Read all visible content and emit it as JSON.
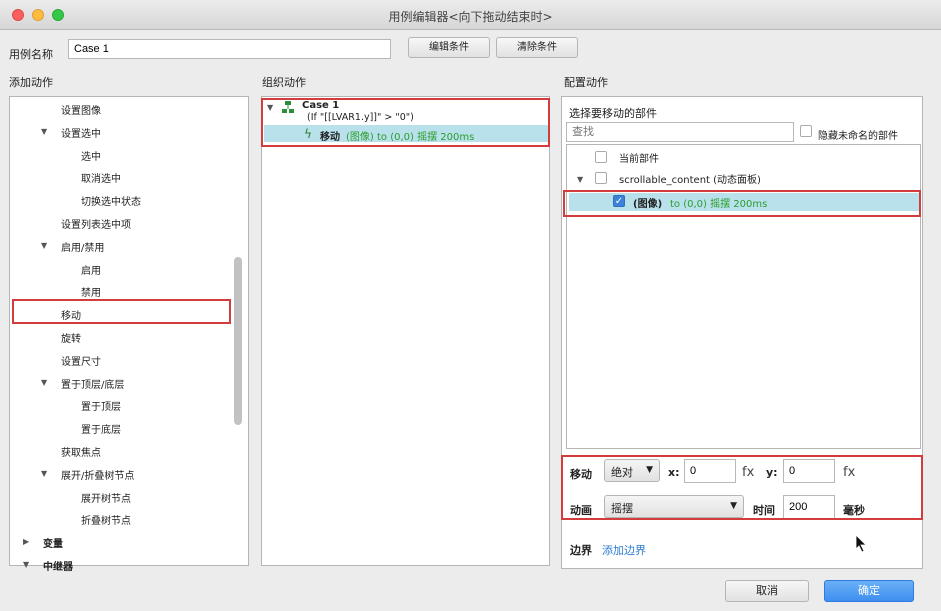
{
  "window": {
    "title": "用例编辑器<向下拖动结束时>"
  },
  "case_name": {
    "label": "用例名称",
    "value": "Case 1"
  },
  "buttons": {
    "edit_conditions": "编辑条件",
    "clear_conditions": "清除条件",
    "cancel": "取消",
    "ok": "确定"
  },
  "sections": {
    "add_action": "添加动作",
    "organize_action": "组织动作",
    "configure_action": "配置动作"
  },
  "add_action_items": [
    {
      "label": "设置图像",
      "indent": 1,
      "expandable": false
    },
    {
      "label": "设置选中",
      "indent": 1,
      "expandable": true
    },
    {
      "label": "选中",
      "indent": 2,
      "expandable": false
    },
    {
      "label": "取消选中",
      "indent": 2,
      "expandable": false
    },
    {
      "label": "切换选中状态",
      "indent": 2,
      "expandable": false
    },
    {
      "label": "设置列表选中项",
      "indent": 1,
      "expandable": false
    },
    {
      "label": "启用/禁用",
      "indent": 1,
      "expandable": true
    },
    {
      "label": "启用",
      "indent": 2,
      "expandable": false
    },
    {
      "label": "禁用",
      "indent": 2,
      "expandable": false
    },
    {
      "label": "移动",
      "indent": 1,
      "expandable": false,
      "selected": true
    },
    {
      "label": "旋转",
      "indent": 1,
      "expandable": false
    },
    {
      "label": "设置尺寸",
      "indent": 1,
      "expandable": false
    },
    {
      "label": "置于顶层/底层",
      "indent": 1,
      "expandable": true
    },
    {
      "label": "置于顶层",
      "indent": 2,
      "expandable": false
    },
    {
      "label": "置于底层",
      "indent": 2,
      "expandable": false
    },
    {
      "label": "获取焦点",
      "indent": 1,
      "expandable": false
    },
    {
      "label": "展开/折叠树节点",
      "indent": 1,
      "expandable": true
    },
    {
      "label": "展开树节点",
      "indent": 2,
      "expandable": false
    },
    {
      "label": "折叠树节点",
      "indent": 2,
      "expandable": false
    },
    {
      "label": "变量",
      "indent": 0,
      "expandable": "collapsed"
    },
    {
      "label": "中继器",
      "indent": 0,
      "expandable": true
    }
  ],
  "organize": {
    "case_title": "Case 1",
    "condition": "(If \"[[LVAR1.y]]\" > \"0\")",
    "action_prefix": "移动",
    "action_detail": "(图像) to (0,0) 摇摆 200ms"
  },
  "configure": {
    "select_widget_label": "选择要移动的部件",
    "search_placeholder": "查找",
    "hide_unnamed_label": "隐藏未命名的部件",
    "widgets": {
      "current": "当前部件",
      "parent": "scrollable_content (动态面板)",
      "image_prefix": "(图像)",
      "image_detail": "to (0,0) 摇摆 200ms"
    },
    "move_label": "移动",
    "move_mode": "绝对",
    "x_label": "x:",
    "x_value": "0",
    "y_label": "y:",
    "y_value": "0",
    "fx": "fx",
    "anim_label": "动画",
    "anim_value": "摇摆",
    "time_label": "时间",
    "time_value": "200",
    "time_unit": "毫秒",
    "border_label": "边界",
    "add_border": "添加边界"
  }
}
